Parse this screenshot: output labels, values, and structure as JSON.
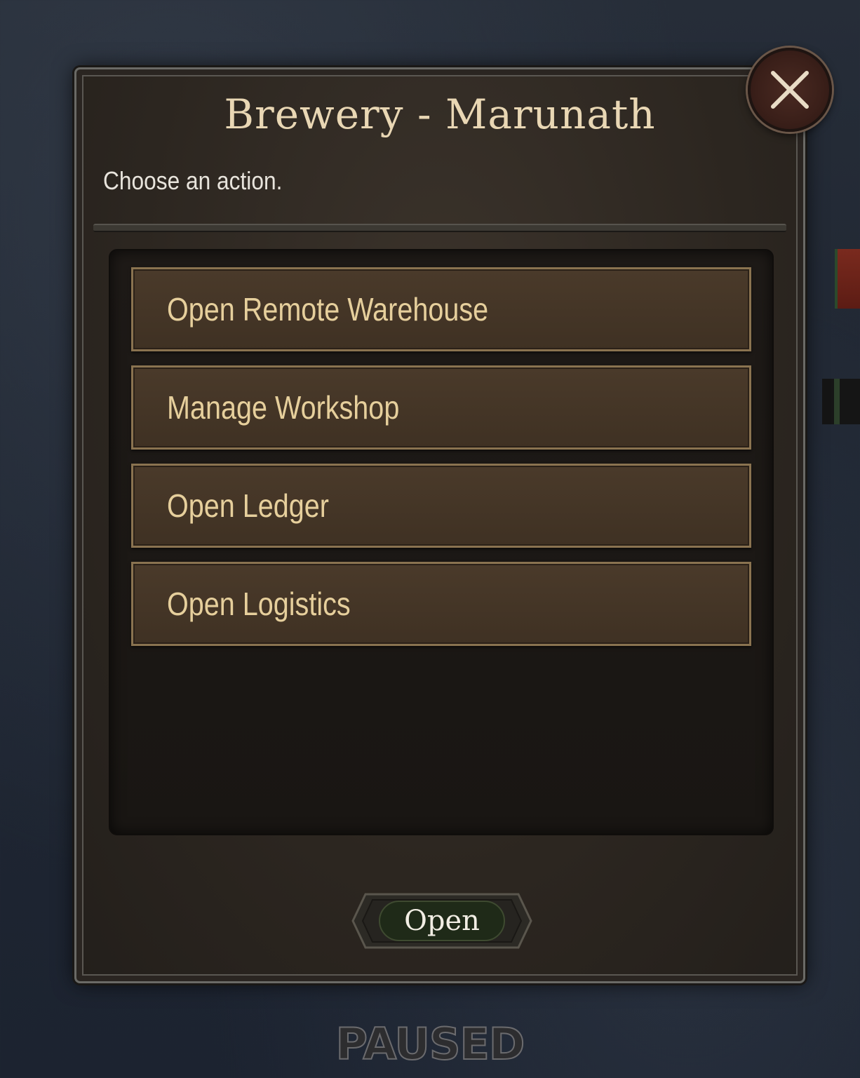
{
  "dialog": {
    "title": "Brewery - Marunath",
    "subtitle": "Choose an action.",
    "actions": [
      {
        "label": "Open Remote Warehouse"
      },
      {
        "label": "Manage Workshop"
      },
      {
        "label": "Open Ledger"
      },
      {
        "label": "Open Logistics"
      }
    ],
    "open_button_label": "Open",
    "close_icon": "close-x-icon"
  },
  "status": {
    "paused_text": "PAUSED"
  },
  "colors": {
    "title_text": "#e9d7b4",
    "action_text": "#e6cf9c",
    "action_border": "#8a7350",
    "action_fill": "#4a3a2a",
    "open_button_fill": "#1f2a18",
    "close_button_fill": "#3a1f19"
  }
}
